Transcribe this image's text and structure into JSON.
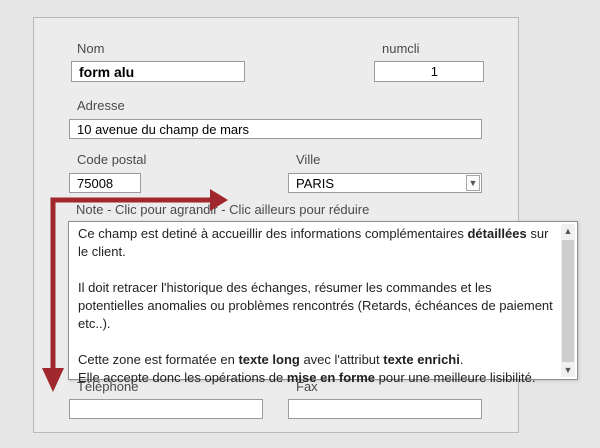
{
  "fields": {
    "nom": {
      "label": "Nom",
      "value": "form alu"
    },
    "numcli": {
      "label": "numcli",
      "value": "1"
    },
    "adresse": {
      "label": "Adresse",
      "value": "10 avenue du champ de mars"
    },
    "code_postal": {
      "label": "Code postal",
      "value": "75008"
    },
    "ville": {
      "label": "Ville",
      "value": "PARIS"
    },
    "telephone": {
      "label": "Téléphone",
      "value": ""
    },
    "fax": {
      "label": "Fax",
      "value": ""
    }
  },
  "note": {
    "label": "Note - Clic pour agrandir - Clic ailleurs pour réduire",
    "paragraphs": [
      [
        "Ce champ est detiné à accueillir des informations complémentaires ",
        {
          "b": "détaillées"
        },
        " sur le client."
      ],
      [
        "Il doit retracer l'historique des échanges, résumer les commandes et les potentielles anomalies ou problèmes rencontrés (Retards, échéances de paiement etc..)."
      ],
      [
        "Cette zone est formatée en ",
        {
          "b": "texte long"
        },
        " avec l'attribut ",
        {
          "b": "texte enrichi"
        },
        "."
      ],
      [
        "Elle accepte donc les opérations de ",
        {
          "b": "mise en forme"
        },
        " pour une meilleure lisibilité."
      ]
    ]
  },
  "icons": {
    "combo": "chevron-down-icon",
    "scroll_up": "chevron-up-icon",
    "scroll_down": "chevron-down-icon"
  },
  "colors": {
    "arrow": "#a0282c",
    "form_bg": "#ececec",
    "page_bg": "#e6e6e6"
  }
}
